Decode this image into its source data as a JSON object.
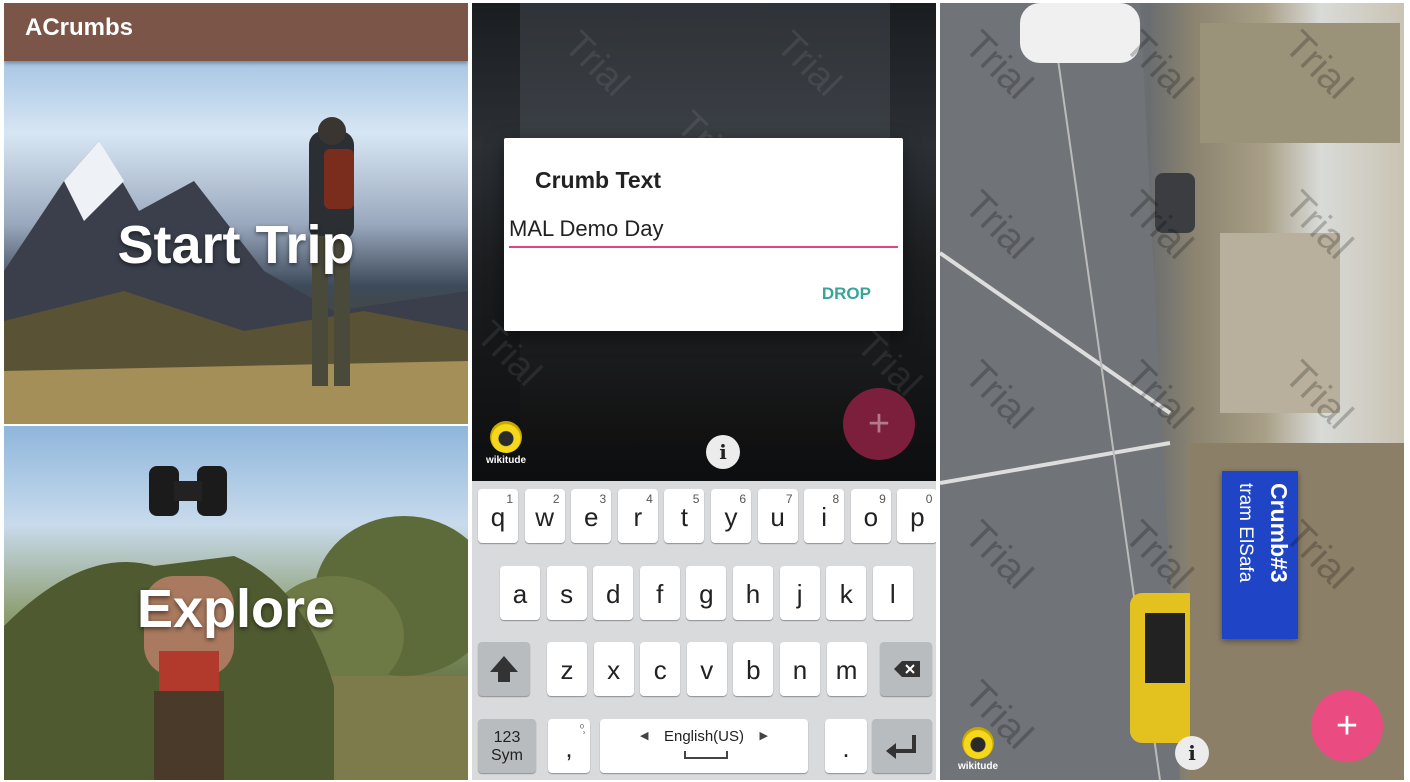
{
  "screen1": {
    "app_title": "ACrumbs",
    "start_trip_label": "Start Trip",
    "explore_label": "Explore"
  },
  "screen2": {
    "dialog_title": "Crumb Text",
    "input_value": "MAL Demo Day",
    "drop_button": "DROP",
    "logo_text": "wikitude",
    "info_label": "i",
    "add_label": "+",
    "watermark": "Trial",
    "keyboard": {
      "row1": [
        {
          "k": "q",
          "n": "1"
        },
        {
          "k": "w",
          "n": "2"
        },
        {
          "k": "e",
          "n": "3"
        },
        {
          "k": "r",
          "n": "4"
        },
        {
          "k": "t",
          "n": "5"
        },
        {
          "k": "y",
          "n": "6"
        },
        {
          "k": "u",
          "n": "7"
        },
        {
          "k": "i",
          "n": "8"
        },
        {
          "k": "o",
          "n": "9"
        },
        {
          "k": "p",
          "n": "0"
        }
      ],
      "row2": [
        "a",
        "s",
        "d",
        "f",
        "g",
        "h",
        "j",
        "k",
        "l"
      ],
      "row3": [
        "z",
        "x",
        "c",
        "v",
        "b",
        "n",
        "m"
      ],
      "sym_line1": "123",
      "sym_line2": "Sym",
      "comma": ",",
      "period": ".",
      "language": "English(US)",
      "lang_left": "◀",
      "lang_right": "▶"
    }
  },
  "screen3": {
    "crumb_title": "Crumb#3",
    "crumb_subtitle": "tram ElSafa",
    "logo_text": "wikitude",
    "info_label": "i",
    "add_label": "+",
    "watermark": "Trial"
  },
  "colors": {
    "app_bar": "#7a5548",
    "input_underline": "#e0467a",
    "drop_text": "#3aa49a",
    "fab_dim": "#7c1f3d",
    "fab_pink": "#ea4c82",
    "crumb_card": "#1f45c6"
  }
}
